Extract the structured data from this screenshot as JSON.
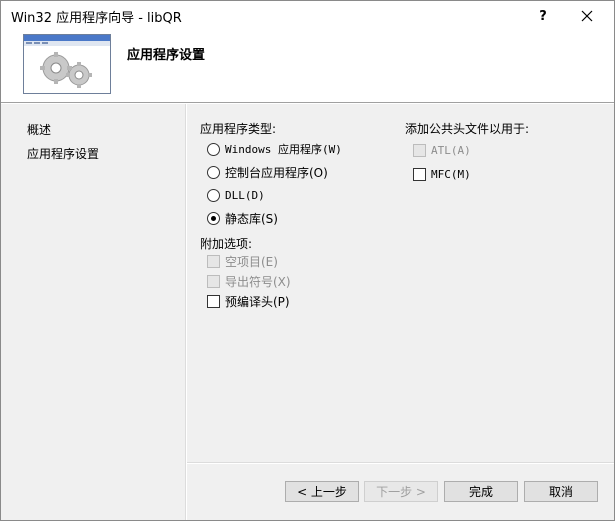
{
  "window": {
    "title": "Win32 应用程序向导 - libQR",
    "help_label": "?",
    "close_label": "✕"
  },
  "header": {
    "title": "应用程序设置"
  },
  "nav": {
    "items": [
      {
        "label": "概述"
      },
      {
        "label": "应用程序设置"
      }
    ]
  },
  "app_type": {
    "label": "应用程序类型:",
    "options": [
      {
        "label": "Windows 应用程序(W)",
        "selected": false
      },
      {
        "label": "控制台应用程序(O)",
        "selected": false
      },
      {
        "label": "DLL(D)",
        "selected": false
      },
      {
        "label": "静态库(S)",
        "selected": true
      }
    ]
  },
  "extra_options": {
    "label": "附加选项:",
    "options": [
      {
        "label": "空项目(E)",
        "checked": false,
        "enabled": false
      },
      {
        "label": "导出符号(X)",
        "checked": false,
        "enabled": false
      },
      {
        "label": "预编译头(P)",
        "checked": false,
        "enabled": true
      }
    ]
  },
  "common_headers": {
    "label": "添加公共头文件以用于:",
    "options": [
      {
        "label": "ATL(A)",
        "checked": false,
        "enabled": false
      },
      {
        "label": "MFC(M)",
        "checked": false,
        "enabled": true
      }
    ]
  },
  "buttons": {
    "prev": "< 上一步",
    "next": "下一步 >",
    "finish": "完成",
    "cancel": "取消"
  }
}
